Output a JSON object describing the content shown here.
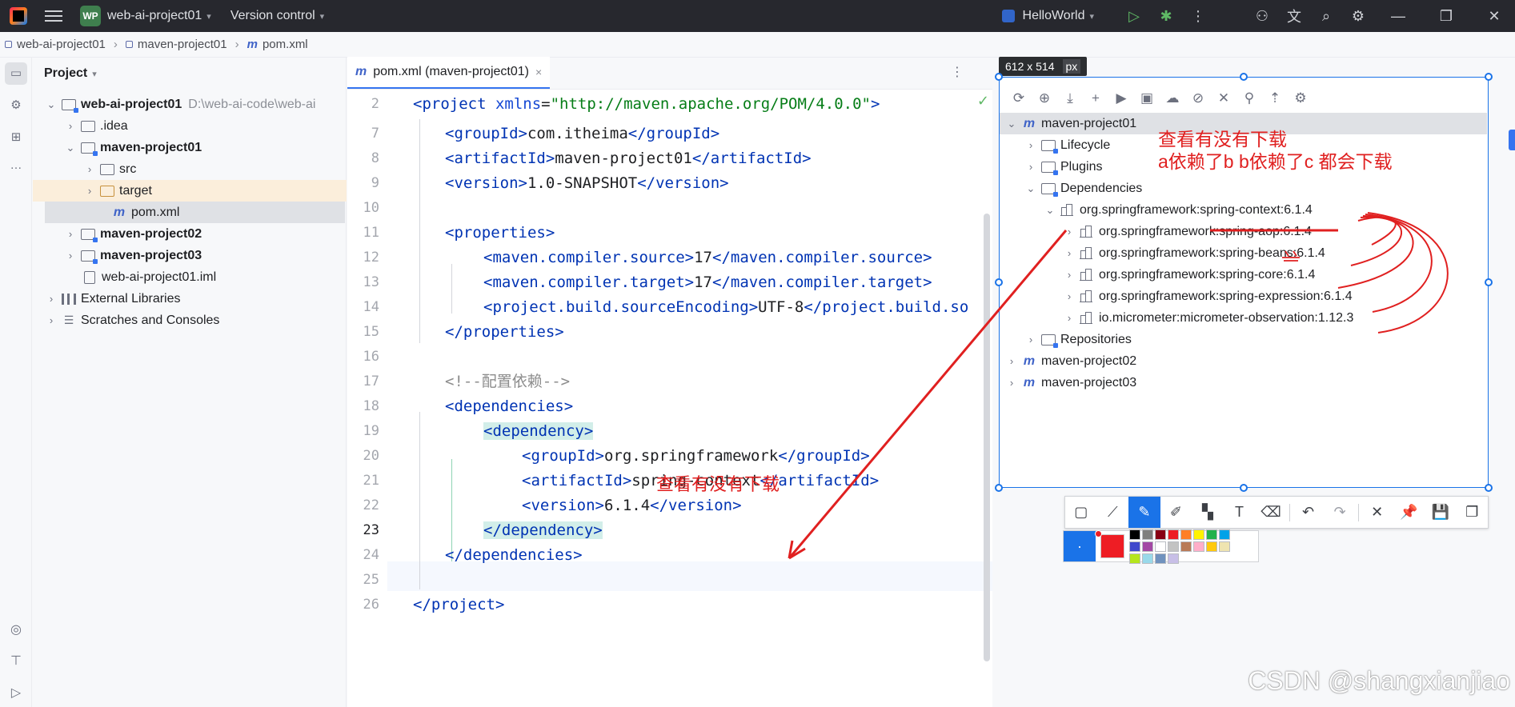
{
  "titlebar": {
    "project_badge": "WP",
    "project_name": "web-ai-project01",
    "vcs": "Version control",
    "run_config": "HelloWorld"
  },
  "breadcrumb": [
    "web-ai-project01",
    "maven-project01",
    "pom.xml"
  ],
  "project_panel": {
    "title": "Project",
    "items": [
      {
        "label": "web-ai-project01",
        "path": "D:\\web-ai-code\\web-ai"
      },
      {
        "label": ".idea"
      },
      {
        "label": "maven-project01"
      },
      {
        "label": "src"
      },
      {
        "label": "target"
      },
      {
        "label": "pom.xml"
      },
      {
        "label": "maven-project02"
      },
      {
        "label": "maven-project03"
      },
      {
        "label": "web-ai-project01.iml"
      },
      {
        "label": "External Libraries"
      },
      {
        "label": "Scratches and Consoles"
      }
    ]
  },
  "editor": {
    "tab_label": "pom.xml (maven-project01)",
    "line_numbers": [
      "2",
      "7",
      "8",
      "9",
      "10",
      "11",
      "12",
      "13",
      "14",
      "15",
      "16",
      "17",
      "18",
      "19",
      "20",
      "21",
      "22",
      "23",
      "24",
      "25",
      "26"
    ],
    "lines": {
      "l2": {
        "open": "<project ",
        "attr": "xmlns",
        "eq": "=",
        "str": "\"http://maven.apache.org/POM/4.0.0\"",
        "close": ">"
      },
      "l7": {
        "t1": "<groupId>",
        "v": "com.itheima",
        "t2": "</groupId>"
      },
      "l8": {
        "t1": "<artifactId>",
        "v": "maven-project01",
        "t2": "</artifactId>"
      },
      "l9": {
        "t1": "<version>",
        "v": "1.0-SNAPSHOT",
        "t2": "</version>"
      },
      "l11": {
        "t1": "<properties>"
      },
      "l12": {
        "t1": "<maven.compiler.source>",
        "v": "17",
        "t2": "</maven.compiler.source>"
      },
      "l13": {
        "t1": "<maven.compiler.target>",
        "v": "17",
        "t2": "</maven.compiler.target>"
      },
      "l14": {
        "t1": "<project.build.sourceEncoding>",
        "v": "UTF-8",
        "t2": "</project.build.so"
      },
      "l15": {
        "t1": "</properties>"
      },
      "l17": {
        "c": "<!--配置依赖-->"
      },
      "l18": {
        "t1": "<dependencies>"
      },
      "l19": {
        "t1": "<dependency>"
      },
      "l20": {
        "t1": "<groupId>",
        "v": "org.springframework",
        "t2": "</groupId>"
      },
      "l21": {
        "t1": "<artifactId>",
        "v": "spring-context",
        "t2": "</artifactId>"
      },
      "l22": {
        "t1": "<version>",
        "v": "6.1.4",
        "t2": "</version>"
      },
      "l23": {
        "t1": "</dependency>"
      },
      "l24": {
        "t1": "</dependencies>"
      },
      "l26": {
        "t1": "</project>"
      }
    },
    "annotation": "查看有没有下载"
  },
  "capture": {
    "size_label": "612 x 514",
    "unit": "px",
    "maven_tree": [
      {
        "label": "maven-project01"
      },
      {
        "label": "Lifecycle"
      },
      {
        "label": "Plugins"
      },
      {
        "label": "Dependencies"
      },
      {
        "label": "org.springframework:spring-context:6.1.4"
      },
      {
        "label": "org.springframework:spring-aop:6.1.4"
      },
      {
        "label": "org.springframework:spring-beans:6.1.4"
      },
      {
        "label": "org.springframework:spring-core:6.1.4"
      },
      {
        "label": "org.springframework:spring-expression:6.1.4"
      },
      {
        "label": "io.micrometer:micrometer-observation:1.12.3"
      },
      {
        "label": "Repositories"
      },
      {
        "label": "maven-project02"
      },
      {
        "label": "maven-project03"
      }
    ],
    "note_line1": "查看有没有下载",
    "note_line2": "a依赖了b b依赖了c 都会下载"
  },
  "watermark": "CSDN @shangxianjiao",
  "colors": {
    "accent": "#1a73e8",
    "annotation_red": "#e02020",
    "swatches": [
      "#000000",
      "#7f7f7f",
      "#880015",
      "#ed1c24",
      "#ff7f27",
      "#fff200",
      "#22b14c",
      "#00a2e8",
      "#3f48cc",
      "#a349a4",
      "#ffffff",
      "#c3c3c3",
      "#b97a57",
      "#ffaec9",
      "#ffc90e",
      "#efe4b0",
      "#b5e61d",
      "#99d9ea",
      "#7092be",
      "#c8bfe7"
    ]
  }
}
